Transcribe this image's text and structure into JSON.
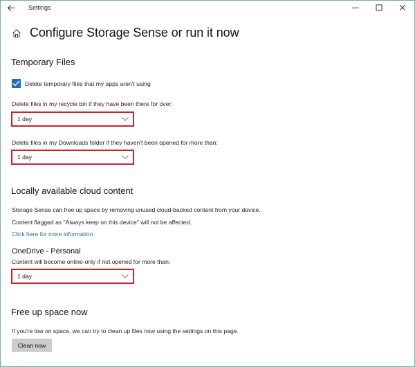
{
  "window": {
    "app_title": "Settings",
    "controls": {
      "minimize": "minimize-icon",
      "maximize": "maximize-icon",
      "close": "close-icon"
    }
  },
  "header": {
    "back_icon": "back-arrow-icon",
    "home_icon": "home-icon",
    "title": "Configure Storage Sense or run it now"
  },
  "temporary_files": {
    "heading": "Temporary Files",
    "checkbox": {
      "label": "Delete temporary files that my apps aren't using",
      "checked": true
    },
    "recycle_bin": {
      "label": "Delete files in my recycle bin if they have been there for over:",
      "value": "1 day"
    },
    "downloads": {
      "label": "Delete files in my Downloads folder if they haven't been opened for more than:",
      "value": "1 day"
    }
  },
  "cloud_content": {
    "heading": "Locally available cloud content",
    "description_1": "Storage Sense can free up space by removing unused cloud-backed content from your device.",
    "description_2": "Content flagged as \"Always keep on this device\" will not be affected.",
    "link": "Click here for more information",
    "onedrive": {
      "title": "OneDrive - Personal",
      "label": "Content will become online-only if not opened for more than:",
      "value": "1 day"
    }
  },
  "free_up": {
    "heading": "Free up space now",
    "description": "If you're low on space, we can try to clean up files now using the settings on this page.",
    "button": "Clean now"
  },
  "colors": {
    "accent": "#1f6db5",
    "highlight": "#d0202e",
    "link": "#1a6a9c",
    "button_bg": "#cccccc"
  }
}
